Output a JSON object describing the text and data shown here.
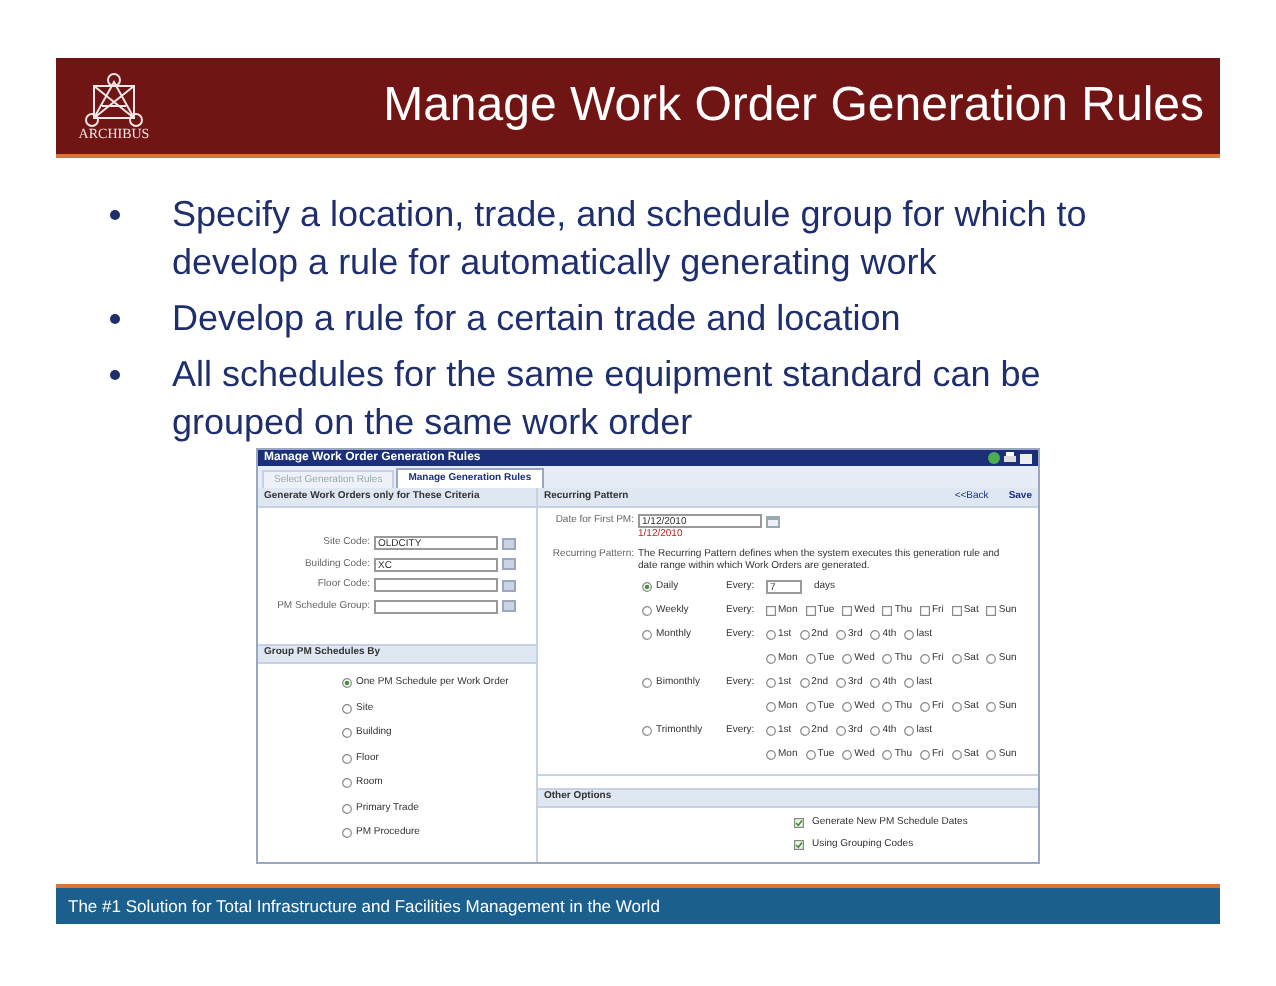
{
  "header": {
    "logo_text": "ARCHIBUS",
    "title": "Manage Work Order Generation Rules"
  },
  "bullets": [
    "Specify a location, trade, and schedule group for which to develop a rule for automatically generating work",
    "Develop a rule for a certain trade and location",
    "All schedules for the same equipment standard can be grouped on the same work order"
  ],
  "app": {
    "title": "Manage Work Order Generation Rules",
    "tabs": [
      {
        "label": "Select Generation Rules",
        "selected": false
      },
      {
        "label": "Manage Generation Rules",
        "selected": true
      }
    ],
    "criteria": {
      "heading": "Generate Work Orders only for These Criteria",
      "fields": [
        {
          "label": "Site Code:",
          "value": "OLDCITY"
        },
        {
          "label": "Building Code:",
          "value": "XC"
        },
        {
          "label": "Floor Code:"
        },
        {
          "label": "PM Schedule Group:"
        }
      ]
    },
    "group_by": {
      "heading": "Group PM Schedules By",
      "options": [
        {
          "label": "One PM Schedule per Work Order",
          "selected": true
        },
        {
          "label": "Site",
          "selected": false
        },
        {
          "label": "Building",
          "selected": false
        },
        {
          "label": "Floor",
          "selected": false
        },
        {
          "label": "Room",
          "selected": false
        },
        {
          "label": "Primary Trade",
          "selected": false
        },
        {
          "label": "PM Procedure",
          "selected": false
        }
      ]
    },
    "recurring": {
      "heading": "Recurring Pattern",
      "back": "<<Back",
      "save": "Save",
      "date_label": "Date for First PM:",
      "date_value": "1/12/2010",
      "date_hint": "1/12/2010",
      "pattern_label": "Recurring Pattern:",
      "pattern_text": "The Recurring Pattern defines when the system executes this generation rule and date range within which Work Orders are generated.",
      "patterns": [
        {
          "label": "Daily",
          "selected": true,
          "every": "Every:",
          "kind": "days",
          "value": "7",
          "unit": "days"
        },
        {
          "label": "Weekly",
          "selected": false,
          "every": "Every:",
          "kind": "weekdays",
          "days": [
            {
              "label": "Mon",
              "checked": false
            },
            {
              "label": "Tue",
              "checked": false
            },
            {
              "label": "Wed",
              "checked": false
            },
            {
              "label": "Thu",
              "checked": false
            },
            {
              "label": "Fri",
              "checked": false
            },
            {
              "label": "Sat",
              "checked": false
            },
            {
              "label": "Sun",
              "checked": false
            }
          ]
        },
        {
          "label": "Monthly",
          "selected": false,
          "every": "Every:",
          "kind": "ordinal",
          "ordinals": [
            {
              "label": "1st",
              "selected": false
            },
            {
              "label": "2nd",
              "selected": false
            },
            {
              "label": "3rd",
              "selected": false
            },
            {
              "label": "4th",
              "selected": false
            },
            {
              "label": "last",
              "selected": false
            }
          ],
          "days": [
            {
              "label": "Mon",
              "selected": false
            },
            {
              "label": "Tue",
              "selected": false
            },
            {
              "label": "Wed",
              "selected": false
            },
            {
              "label": "Thu",
              "selected": false
            },
            {
              "label": "Fri",
              "selected": false
            },
            {
              "label": "Sat",
              "selected": false
            },
            {
              "label": "Sun",
              "selected": false
            }
          ]
        },
        {
          "label": "Bimonthly",
          "selected": false,
          "every": "Every:",
          "kind": "ordinal",
          "ordinals": [
            {
              "label": "1st",
              "selected": false
            },
            {
              "label": "2nd",
              "selected": false
            },
            {
              "label": "3rd",
              "selected": false
            },
            {
              "label": "4th",
              "selected": false
            },
            {
              "label": "last",
              "selected": false
            }
          ],
          "days": [
            {
              "label": "Mon",
              "selected": false
            },
            {
              "label": "Tue",
              "selected": false
            },
            {
              "label": "Wed",
              "selected": false
            },
            {
              "label": "Thu",
              "selected": false
            },
            {
              "label": "Fri",
              "selected": false
            },
            {
              "label": "Sat",
              "selected": false
            },
            {
              "label": "Sun",
              "selected": false
            }
          ]
        },
        {
          "label": "Trimonthly",
          "selected": false,
          "every": "Every:",
          "kind": "ordinal",
          "ordinals": [
            {
              "label": "1st",
              "selected": false
            },
            {
              "label": "2nd",
              "selected": false
            },
            {
              "label": "3rd",
              "selected": false
            },
            {
              "label": "4th",
              "selected": false
            },
            {
              "label": "last",
              "selected": false
            }
          ],
          "days": [
            {
              "label": "Mon",
              "selected": false
            },
            {
              "label": "Tue",
              "selected": false
            },
            {
              "label": "Wed",
              "selected": false
            },
            {
              "label": "Thu",
              "selected": false
            },
            {
              "label": "Fri",
              "selected": false
            },
            {
              "label": "Sat",
              "selected": false
            },
            {
              "label": "Sun",
              "selected": false
            }
          ]
        }
      ]
    },
    "other": {
      "heading": "Other Options",
      "checkboxes": [
        {
          "label": "Generate New PM Schedule Dates",
          "checked": true
        },
        {
          "label": "Using Grouping Codes",
          "checked": true
        }
      ]
    }
  },
  "footer": "The #1 Solution for Total Infrastructure and Facilities Management in the World"
}
